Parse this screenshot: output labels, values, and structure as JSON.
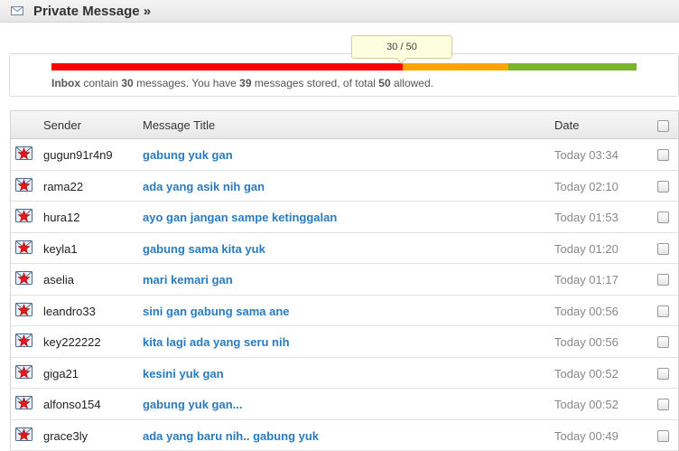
{
  "header": {
    "title": "Private Message »"
  },
  "quota": {
    "tooltip": "30 / 50",
    "usage_fraction": 0.6,
    "inbox_label": "Inbox",
    "text_1": " contain ",
    "inbox_count": "30",
    "text_2": " messages. You have ",
    "stored_count": "39",
    "text_3": " messages stored, of total ",
    "total_allowed": "50",
    "text_4": " allowed.",
    "colors": {
      "red": "#ff0000",
      "orange": "#ffa500",
      "green": "#7ab32e"
    }
  },
  "table": {
    "headers": {
      "sender": "Sender",
      "title": "Message Title",
      "date": "Date"
    },
    "rows": [
      {
        "sender": "gugun91r4n9",
        "title": "gabung yuk gan",
        "date": "Today 03:34"
      },
      {
        "sender": "rama22",
        "title": "ada yang asik nih gan",
        "date": "Today 02:10"
      },
      {
        "sender": "hura12",
        "title": "ayo gan jangan sampe ketinggalan",
        "date": "Today 01:53"
      },
      {
        "sender": "keyla1",
        "title": "gabung sama kita yuk",
        "date": "Today 01:20"
      },
      {
        "sender": "aselia",
        "title": "mari kemari gan",
        "date": "Today 01:17"
      },
      {
        "sender": "leandro33",
        "title": "sini gan gabung sama ane",
        "date": "Today 00:56"
      },
      {
        "sender": "key222222",
        "title": "kita lagi ada yang seru nih",
        "date": "Today 00:56"
      },
      {
        "sender": "giga21",
        "title": "kesini yuk gan",
        "date": "Today 00:52"
      },
      {
        "sender": "alfonso154",
        "title": "gabung yuk gan...",
        "date": "Today 00:52"
      },
      {
        "sender": "grace3ly",
        "title": "ada yang baru nih.. gabung yuk",
        "date": "Today 00:49"
      }
    ]
  },
  "icons": {
    "header": "envelope-icon",
    "row": "unread-message-star-icon"
  }
}
